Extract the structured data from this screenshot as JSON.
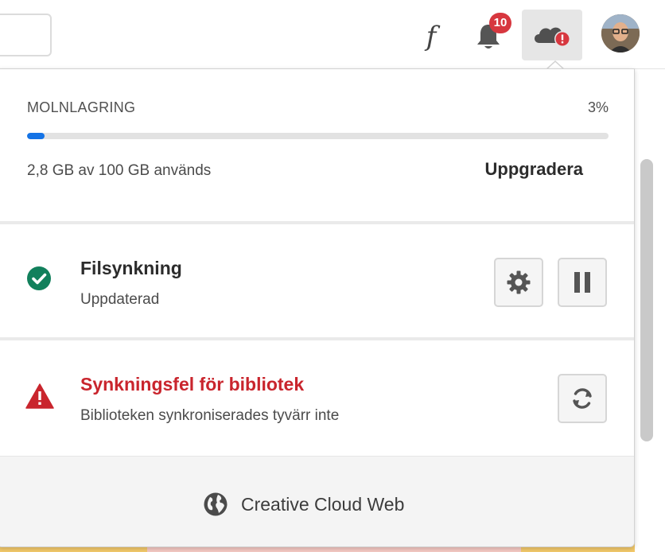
{
  "header": {
    "notification_count": "10",
    "icons": [
      "search-field",
      "font-icon",
      "bell-icon",
      "cloud-alert-icon",
      "avatar"
    ],
    "font_icon_glyph": "f"
  },
  "storage": {
    "label": "MOLNLAGRING",
    "percent_text": "3%",
    "percent_value": 3,
    "used_text": "2,8 GB av 100 GB används",
    "upgrade_label": "Uppgradera",
    "bar_color": "#1473e6"
  },
  "file_sync": {
    "title": "Filsynkning",
    "status": "Uppdaterad",
    "status_icon": "check-circle-icon",
    "status_color": "#12805c",
    "actions": [
      "settings-gear-icon",
      "pause-icon"
    ]
  },
  "library_sync": {
    "title": "Synkningsfel för bibliotek",
    "message": "Biblioteken synkroniserades tyvärr inte",
    "status_icon": "alert-triangle-icon",
    "title_color": "#c9252d",
    "actions": [
      "refresh-icon"
    ]
  },
  "footer": {
    "link_label": "Creative Cloud Web",
    "icon": "globe-icon"
  }
}
